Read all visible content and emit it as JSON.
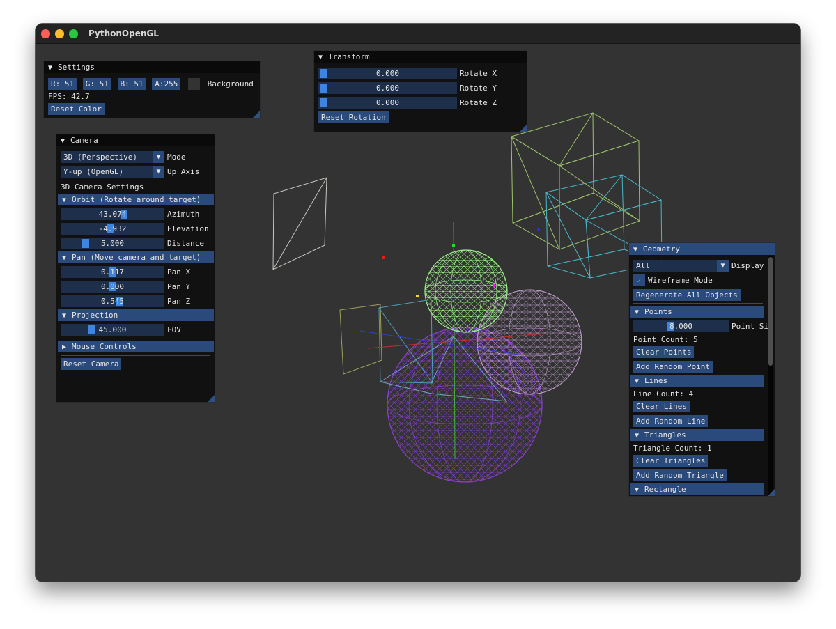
{
  "window": {
    "title": "PythonOpenGL"
  },
  "settings": {
    "title": "Settings",
    "r": "R: 51",
    "g": "G: 51",
    "b": "B: 51",
    "a": "A:255",
    "background_label": "Background",
    "fps": "FPS: 42.7",
    "reset_color": "Reset Color"
  },
  "transform": {
    "title": "Transform",
    "rotate_x": {
      "value": "0.000",
      "label": "Rotate X"
    },
    "rotate_y": {
      "value": "0.000",
      "label": "Rotate Y"
    },
    "rotate_z": {
      "value": "0.000",
      "label": "Rotate Z"
    },
    "reset_rotation": "Reset Rotation"
  },
  "camera": {
    "title": "Camera",
    "mode": {
      "value": "3D (Perspective)",
      "label": "Mode"
    },
    "up_axis": {
      "value": "Y-up (OpenGL)",
      "label": "Up Axis"
    },
    "settings_label": "3D Camera Settings",
    "orbit_header": "Orbit (Rotate around target)",
    "azimuth": {
      "value": "43.074",
      "label": "Azimuth"
    },
    "elevation": {
      "value": "-4.932",
      "label": "Elevation"
    },
    "distance": {
      "value": "5.000",
      "label": "Distance"
    },
    "pan_header": "Pan (Move camera and target)",
    "pan_x": {
      "value": "0.117",
      "label": "Pan X"
    },
    "pan_y": {
      "value": "0.000",
      "label": "Pan Y"
    },
    "pan_z": {
      "value": "0.545",
      "label": "Pan Z"
    },
    "projection_header": "Projection",
    "fov": {
      "value": "45.000",
      "label": "FOV"
    },
    "mouse_controls_header": "Mouse Controls",
    "reset_camera": "Reset Camera"
  },
  "geometry": {
    "title": "Geometry",
    "display": {
      "value": "All",
      "label": "Display"
    },
    "wireframe": {
      "label": "Wireframe Mode",
      "checked": true
    },
    "regenerate": "Regenerate All Objects",
    "points_header": "Points",
    "point_size": {
      "value": "8.000",
      "label": "Point Si"
    },
    "point_count": "Point Count: 5",
    "clear_points": "Clear Points",
    "add_point": "Add Random Point",
    "lines_header": "Lines",
    "line_count": "Line Count: 4",
    "clear_lines": "Clear Lines",
    "add_line": "Add Random Line",
    "triangles_header": "Triangles",
    "triangle_count": "Triangle Count: 1",
    "clear_triangles": "Clear Triangles",
    "add_triangle": "Add Random Triangle",
    "rectangle_header": "Rectangle"
  },
  "colors": {
    "window_bg": "#333333",
    "panel_bg": "#0f0f0f",
    "accent": "#294a7a",
    "frame": "#1d2f4b",
    "grab": "#3d85e0"
  }
}
